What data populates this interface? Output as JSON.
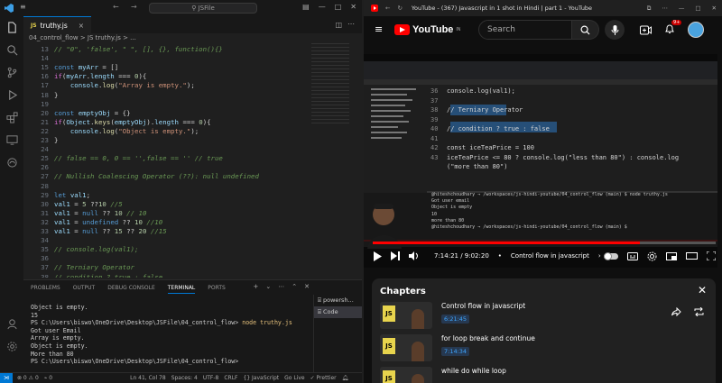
{
  "vscode": {
    "title_search": "JSFile",
    "tab": {
      "icon": "JS",
      "label": "truthy.js",
      "close": "×"
    },
    "breadcrumb": "04_control_flow  >  JS  truthy.js  > ...",
    "lines": [
      {
        "n": "13",
        "html": "<span class='c'>// \"0\", 'false', \" \", [], {}, function(){}</span>"
      },
      {
        "n": "14",
        "html": ""
      },
      {
        "n": "15",
        "html": "<span class='k'>const</span> <span class='v'>myArr</span> <span class='p'>= []</span>"
      },
      {
        "n": "16",
        "html": "<span class='b'>if</span><span class='p'>(</span><span class='v'>myArr</span><span class='p'>.</span><span class='v'>length</span> <span class='p'>===</span> <span class='n'>0</span><span class='p'>){</span>"
      },
      {
        "n": "17",
        "html": "    <span class='v'>console</span><span class='p'>.</span><span class='f'>log</span><span class='p'>(</span><span class='s'>\"Array is empty.\"</span><span class='p'>);</span>"
      },
      {
        "n": "18",
        "html": "<span class='p'>}</span>"
      },
      {
        "n": "19",
        "html": ""
      },
      {
        "n": "20",
        "html": "<span class='k'>const</span> <span class='v'>emptyObj</span> <span class='p'>= {}</span>"
      },
      {
        "n": "21",
        "html": "<span class='b'>if</span><span class='p'>(</span><span class='v'>Object</span><span class='p'>.</span><span class='f'>keys</span><span class='p'>(</span><span class='v'>emptyObj</span><span class='p'>).</span><span class='v'>length</span> <span class='p'>===</span> <span class='n'>0</span><span class='p'>){</span>"
      },
      {
        "n": "22",
        "html": "    <span class='v'>console</span><span class='p'>.</span><span class='f'>log</span><span class='p'>(</span><span class='s'>\"Object is empty.\"</span><span class='p'>);</span>"
      },
      {
        "n": "23",
        "html": "<span class='p'>}</span>"
      },
      {
        "n": "24",
        "html": ""
      },
      {
        "n": "25",
        "html": "<span class='c'>// false == 0, 0 == '',false == '' // true</span>"
      },
      {
        "n": "26",
        "html": ""
      },
      {
        "n": "27",
        "html": "<span class='c'>// Nullish Coalescing Operator (??): null undefined</span>"
      },
      {
        "n": "28",
        "html": ""
      },
      {
        "n": "29",
        "html": "<span class='k'>let</span> <span class='v'>val1</span><span class='p'>;</span>"
      },
      {
        "n": "30",
        "html": "<span class='v'>val1</span> <span class='p'>=</span> <span class='n'>5</span> <span class='p'>??</span><span class='n'>10</span> <span class='c'>//5</span>"
      },
      {
        "n": "31",
        "html": "<span class='v'>val1</span> <span class='p'>=</span> <span class='k'>null</span> <span class='p'>??</span> <span class='n'>10</span> <span class='c'>// 10</span>"
      },
      {
        "n": "32",
        "html": "<span class='v'>val1</span> <span class='p'>=</span> <span class='k'>undefined</span> <span class='p'>??</span> <span class='n'>10</span> <span class='c'>//10</span>"
      },
      {
        "n": "33",
        "html": "<span class='v'>val1</span> <span class='p'>=</span> <span class='k'>null</span> <span class='p'>??</span> <span class='n'>15</span> <span class='p'>??</span> <span class='n'>20</span> <span class='c'>//15</span>"
      },
      {
        "n": "34",
        "html": ""
      },
      {
        "n": "35",
        "html": "<span class='c'>// console.log(val1);</span>"
      },
      {
        "n": "36",
        "html": ""
      },
      {
        "n": "37",
        "html": "<span class='c'>// Terniary Operator</span>"
      },
      {
        "n": "38",
        "html": "<span class='c'>// condition ? true : false</span>"
      }
    ],
    "panel_tabs": [
      "PROBLEMS",
      "OUTPUT",
      "DEBUG CONSOLE",
      "TERMINAL",
      "PORTS"
    ],
    "terminal": [
      "Object is empty.",
      "15",
      "PS C:\\Users\\biswo\\OneDrive\\Desktop\\JSFile\\04_control_flow> node truthy.js",
      "Got user Email",
      "Array is empty.",
      "Object is empty.",
      "More than 80",
      "PS C:\\Users\\biswo\\OneDrive\\Desktop\\JSFile\\04_control_flow> "
    ],
    "terminal_list": [
      "powersh...",
      "Code"
    ],
    "status": {
      "errors": "⊗ 0 ⚠ 0",
      "ports": "⌁ 0",
      "position": "Ln 41, Col 78",
      "spaces": "Spaces: 4",
      "encoding": "UTF-8",
      "eol": "CRLF",
      "lang": "{} JavaScript",
      "golive": "Go Live",
      "prettier": "✓ Prettier"
    }
  },
  "browser": {
    "title": "YouTube - (367) Javascript in 1 shot in Hindi | part 1 - YouTube",
    "logo": "YouTube",
    "region": "IN",
    "search_placeholder": "Search",
    "notif_count": "9+",
    "video_overlay": {
      "code_lines": [
        {
          "n": "36",
          "t": "console.log(val1);"
        },
        {
          "n": "37",
          "t": ""
        },
        {
          "n": "38",
          "t": "// Terniary Operator"
        },
        {
          "n": "39",
          "t": ""
        },
        {
          "n": "40",
          "t": "// condition ? true : false"
        },
        {
          "n": "41",
          "t": ""
        },
        {
          "n": "42",
          "t": "const iceTeaPrice = 100"
        },
        {
          "n": "43",
          "t": "iceTeaPrice <= 80 ? console.log(\"less than 80\") : console.log"
        },
        {
          "n": "",
          "t": "(\"more than 80\")"
        }
      ],
      "terminal_lines": [
        "@hiteshchoudhary → /workspaces/js-hindi-youtube/04_control_flow (main) $ node truthy.js",
        "Got user email",
        "Object is empty",
        "10",
        "more than 80",
        "@hiteshchoudhary → /workspaces/js-hindi-youtube/04_control_flow (main) $"
      ]
    },
    "player": {
      "progress": 0.78,
      "time": "7:14:21 / 9:02:20",
      "chapter": "Control flow in javascript",
      "chapter_arrow": "›"
    },
    "chapters": {
      "header": "Chapters",
      "items": [
        {
          "title": "Control flow in javascript",
          "time": "6:21:45"
        },
        {
          "title": "for loop break and continue",
          "time": "7:14:34"
        },
        {
          "title": "while do while loop",
          "time": ""
        }
      ]
    }
  }
}
